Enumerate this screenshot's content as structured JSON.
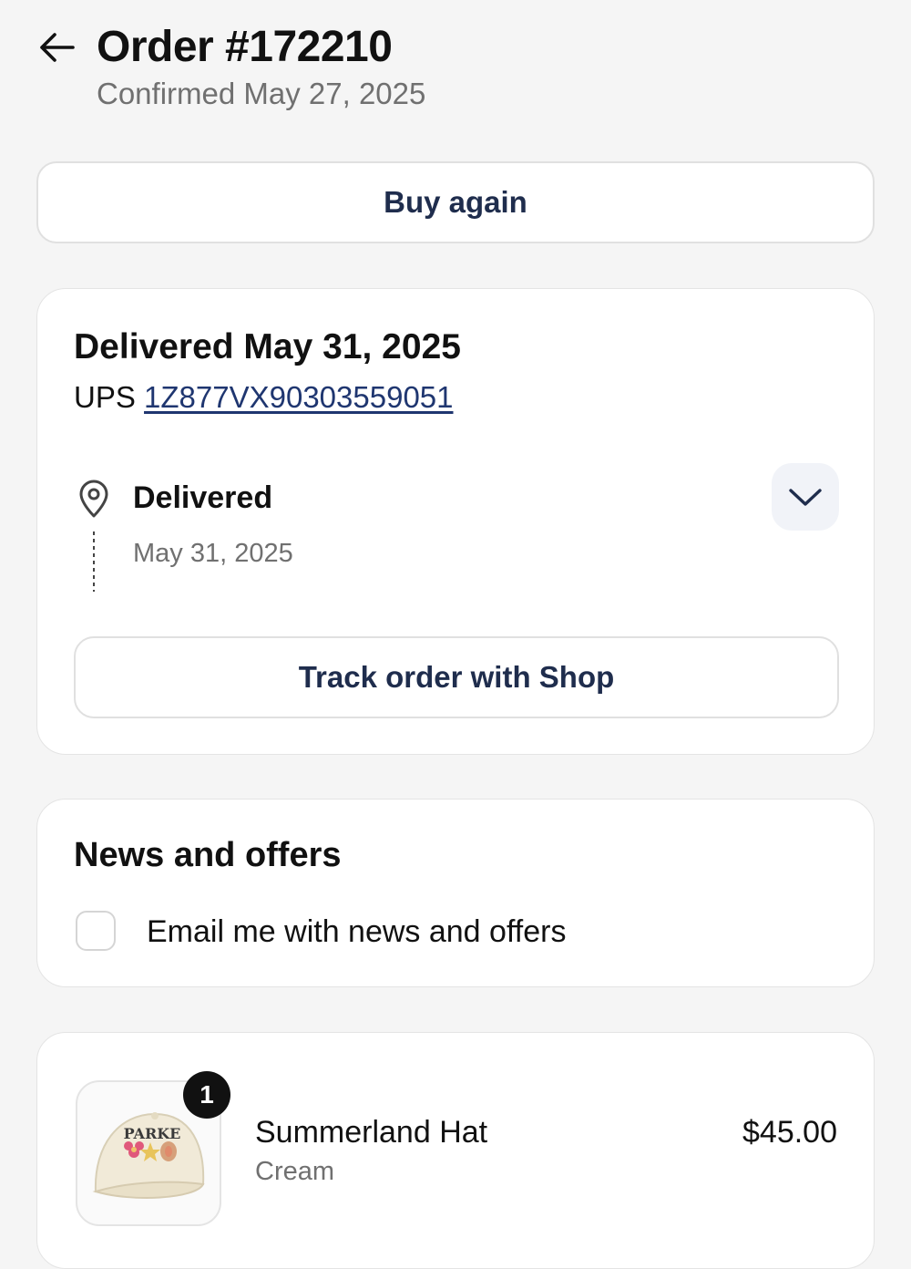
{
  "header": {
    "title": "Order #172210",
    "subtitle": "Confirmed May 27, 2025"
  },
  "actions": {
    "buy_again_label": "Buy again"
  },
  "delivery": {
    "title": "Delivered May 31, 2025",
    "carrier": "UPS",
    "tracking_number": "1Z877VX90303559051",
    "status_title": "Delivered",
    "status_date": "May 31, 2025",
    "track_button_label": "Track order with Shop"
  },
  "news": {
    "title": "News and offers",
    "checkbox_label": "Email me with news and offers",
    "checked": false
  },
  "item": {
    "quantity": "1",
    "name": "Summerland Hat",
    "variant": "Cream",
    "price": "$45.00",
    "image_text": "PARKE"
  },
  "colors": {
    "accent": "#1f2d4d",
    "link": "#1f3670",
    "background": "#f5f5f5"
  }
}
